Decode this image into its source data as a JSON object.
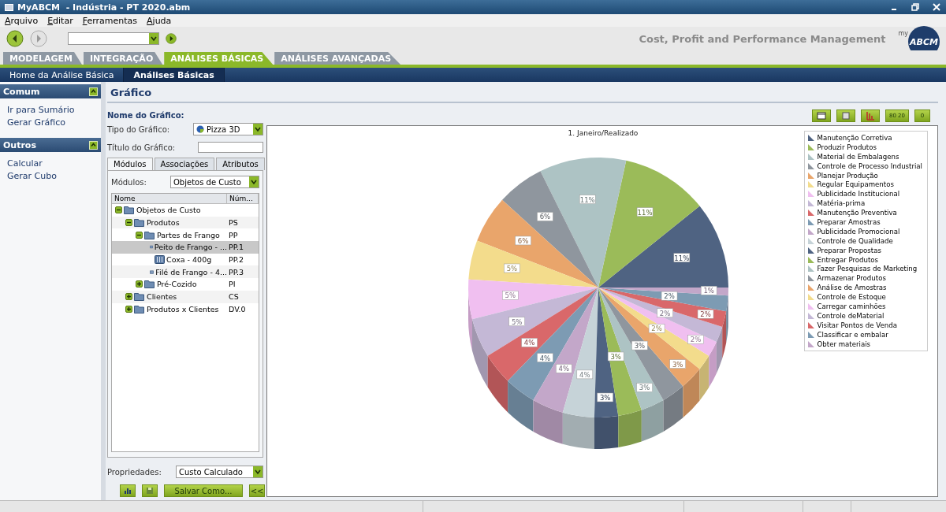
{
  "window": {
    "title": "MyABCM  - Indústria - PT 2020.abm"
  },
  "menu": [
    "Arquivo",
    "Editar",
    "Ferramentas",
    "Ajuda"
  ],
  "toolbar": {
    "tagline": "Cost, Profit and Performance Management",
    "logo": {
      "prefix": "my",
      "text": "ABCM"
    }
  },
  "tabs": [
    {
      "label": "MODELAGEM",
      "selected": false
    },
    {
      "label": "INTEGRAÇÃO",
      "selected": false
    },
    {
      "label": "ANÁLISES BÁSICAS",
      "selected": true
    },
    {
      "label": "ANÁLISES AVANÇADAS",
      "selected": false
    }
  ],
  "subnav": [
    {
      "label": "Home da Análise Básica",
      "selected": false
    },
    {
      "label": "Análises Básicas",
      "selected": true
    }
  ],
  "sidebar": [
    {
      "title": "Comum",
      "expanded": true,
      "items": [
        "Ir para Sumário",
        "Gerar Gráfico"
      ]
    },
    {
      "title": "Outros",
      "expanded": true,
      "items": [
        "Calcular",
        "Gerar Cubo"
      ]
    }
  ],
  "page_title": "Gráfico",
  "form": {
    "name_label": "Nome do Gráfico:",
    "type_label": "Tipo do Gráfico:",
    "type_value": "Pizza 3D",
    "title_label": "Título do Gráfico:"
  },
  "panel_tabs": [
    {
      "label": "Módulos",
      "selected": true
    },
    {
      "label": "Associações",
      "selected": false
    },
    {
      "label": "Atributos",
      "selected": false
    }
  ],
  "modules": {
    "label": "Módulos:",
    "value": "Objetos de Custo"
  },
  "tree": {
    "columns": [
      "Nome",
      "Núm..."
    ],
    "rows": [
      {
        "name": "Objetos de Custo",
        "kind": "folder",
        "expanded": true,
        "selected": false,
        "children": [
          {
            "name": "Produtos",
            "code": "PS",
            "kind": "folder",
            "expanded": true,
            "selected": false,
            "children": [
              {
                "name": "Partes de Frango",
                "code": "PP",
                "kind": "folder",
                "expanded": true,
                "selected": false,
                "children": [
                  {
                    "name": "Peito de Frango - ...",
                    "code": "PP.1",
                    "kind": "item",
                    "selected": true
                  },
                  {
                    "name": "Coxa - 400g",
                    "code": "PP.2",
                    "kind": "item",
                    "selected": false
                  },
                  {
                    "name": "Filé de Frango - 4...",
                    "code": "PP.3",
                    "kind": "item",
                    "selected": false
                  }
                ]
              },
              {
                "name": "Pré-Cozido",
                "code": "PI",
                "kind": "folder",
                "expanded": false,
                "selected": false
              }
            ]
          },
          {
            "name": "Clientes",
            "code": "CS",
            "kind": "folder",
            "expanded": false,
            "selected": false
          },
          {
            "name": "Produtos x Clientes",
            "code": "DV.0",
            "kind": "folder",
            "expanded": false,
            "selected": false
          }
        ]
      }
    ]
  },
  "properties": {
    "label": "Propriedades:",
    "value": "Custo Calculado"
  },
  "actions": {
    "save_as": "Salvar Como...",
    "collapse": "<<"
  },
  "chart_toolbar": [
    {
      "kind": "icon"
    },
    {
      "kind": "icon"
    },
    {
      "kind": "icon"
    },
    {
      "kind": "text",
      "label": "80 20"
    },
    {
      "kind": "text",
      "label": "0"
    }
  ],
  "chart_data": {
    "type": "pie",
    "title": "1. Janeiro/Realizado",
    "data_labels": true,
    "categories": [
      "Manutenção Corretiva",
      "Produzir Produtos",
      "Material de Embalagens",
      "Controle de Processo Industrial",
      "Planejar Produção",
      "Regular Equipamentos",
      "Publicidade Institucional",
      "Matéria-prima",
      "Manutenção Preventiva",
      "Preparar Amostras",
      "Publicidade Promocional",
      "Controle de Qualidade",
      "Preparar Propostas",
      "Entregar Produtos",
      "Fazer Pesquisas de Marketing",
      "Armazenar Produtos",
      "Análise de Amostras",
      "Controle de Estoque",
      "Carregar caminhões",
      "Controle deMaterial",
      "Visitar Pontos de Venda",
      "Classificar e embalar",
      "Obter materiais"
    ],
    "values": [
      11,
      11,
      11,
      6,
      6,
      5,
      5,
      5,
      4,
      4,
      4,
      4,
      3,
      3,
      3,
      3,
      3,
      2,
      2,
      2,
      2,
      2,
      1
    ],
    "value_labels": [
      "11%",
      "11%",
      "11%",
      "6%",
      "6%",
      "5%",
      "5%",
      "5%",
      "4%",
      "4%",
      "4%",
      "4%",
      "3%",
      "3%",
      "3%",
      "3%",
      "3%",
      "2%",
      "2%",
      "2%",
      "2%",
      "2%",
      "1%"
    ],
    "colors": [
      "#4f6382",
      "#9bbb59",
      "#adc3c4",
      "#8f969e",
      "#e9a56b",
      "#f3dc8c",
      "#f0bff0",
      "#c4b8d6",
      "#d9686a",
      "#7d9bb3",
      "#c3a7c9",
      "#c6d3d8",
      "#4f6382",
      "#9bbb59",
      "#adc3c4",
      "#8f969e",
      "#e9a56b",
      "#f3dc8c",
      "#f0bff0",
      "#c4b8d6",
      "#d9686a",
      "#7d9bb3",
      "#c3a7c9"
    ]
  }
}
